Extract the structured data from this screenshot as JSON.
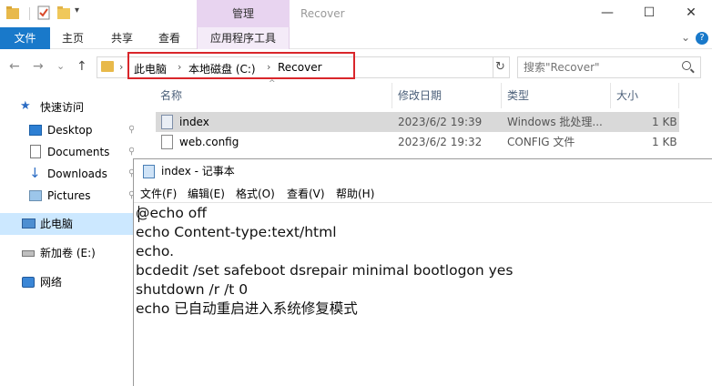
{
  "window": {
    "title": "Recover",
    "minimize": "—",
    "maximize": "☐",
    "close": "✕"
  },
  "ribbon": {
    "context_group_label": "管理",
    "tabs": [
      "文件",
      "主页",
      "共享",
      "查看",
      "应用程序工具"
    ],
    "collapse_glyph": "⌄",
    "help_glyph": "?"
  },
  "nav": {
    "back": "←",
    "forward": "→",
    "history": "⌄",
    "up": "↑",
    "breadcrumbs": [
      "此电脑",
      "本地磁盘 (C:)",
      "Recover"
    ],
    "separator": "›",
    "dropdown": "⌄",
    "refresh": "↻"
  },
  "search": {
    "placeholder": "搜索\"Recover\""
  },
  "sidebar": {
    "items": [
      {
        "label": "快速访问",
        "icon": "star-icon",
        "pinned": false
      },
      {
        "label": "Desktop",
        "icon": "desktop-icon",
        "pinned": true
      },
      {
        "label": "Documents",
        "icon": "documents-icon",
        "pinned": true
      },
      {
        "label": "Downloads",
        "icon": "downloads-icon",
        "pinned": true
      },
      {
        "label": "Pictures",
        "icon": "pictures-icon",
        "pinned": true
      },
      {
        "label": "此电脑",
        "icon": "computer-icon",
        "pinned": false
      },
      {
        "label": "新加卷 (E:)",
        "icon": "drive-icon",
        "pinned": false
      },
      {
        "label": "网络",
        "icon": "network-icon",
        "pinned": false
      }
    ],
    "pin_glyph": "📌"
  },
  "filelist": {
    "columns": [
      "名称",
      "修改日期",
      "类型",
      "大小"
    ],
    "sort_glyph": "^",
    "rows": [
      {
        "name": "index",
        "date": "2023/6/2 19:39",
        "type": "Windows 批处理...",
        "size": "1 KB",
        "selected": true
      },
      {
        "name": "web.config",
        "date": "2023/6/2 19:32",
        "type": "CONFIG 文件",
        "size": "1 KB",
        "selected": false
      }
    ]
  },
  "notepad": {
    "title": "index - 记事本",
    "menu": [
      "文件(F)",
      "编辑(E)",
      "格式(O)",
      "查看(V)",
      "帮助(H)"
    ],
    "lines": [
      "@echo off",
      "echo Content-type:text/html",
      "echo.",
      "bcdedit /set safeboot dsrepair minimal bootlogon yes",
      "shutdown /r /t 0",
      "echo 已自动重启进入系统修复模式"
    ]
  },
  "colors": {
    "accent": "#1979ca",
    "context_tab": "#e8d4f0",
    "selection": "#cce8ff",
    "highlight_box": "#d9262b"
  }
}
